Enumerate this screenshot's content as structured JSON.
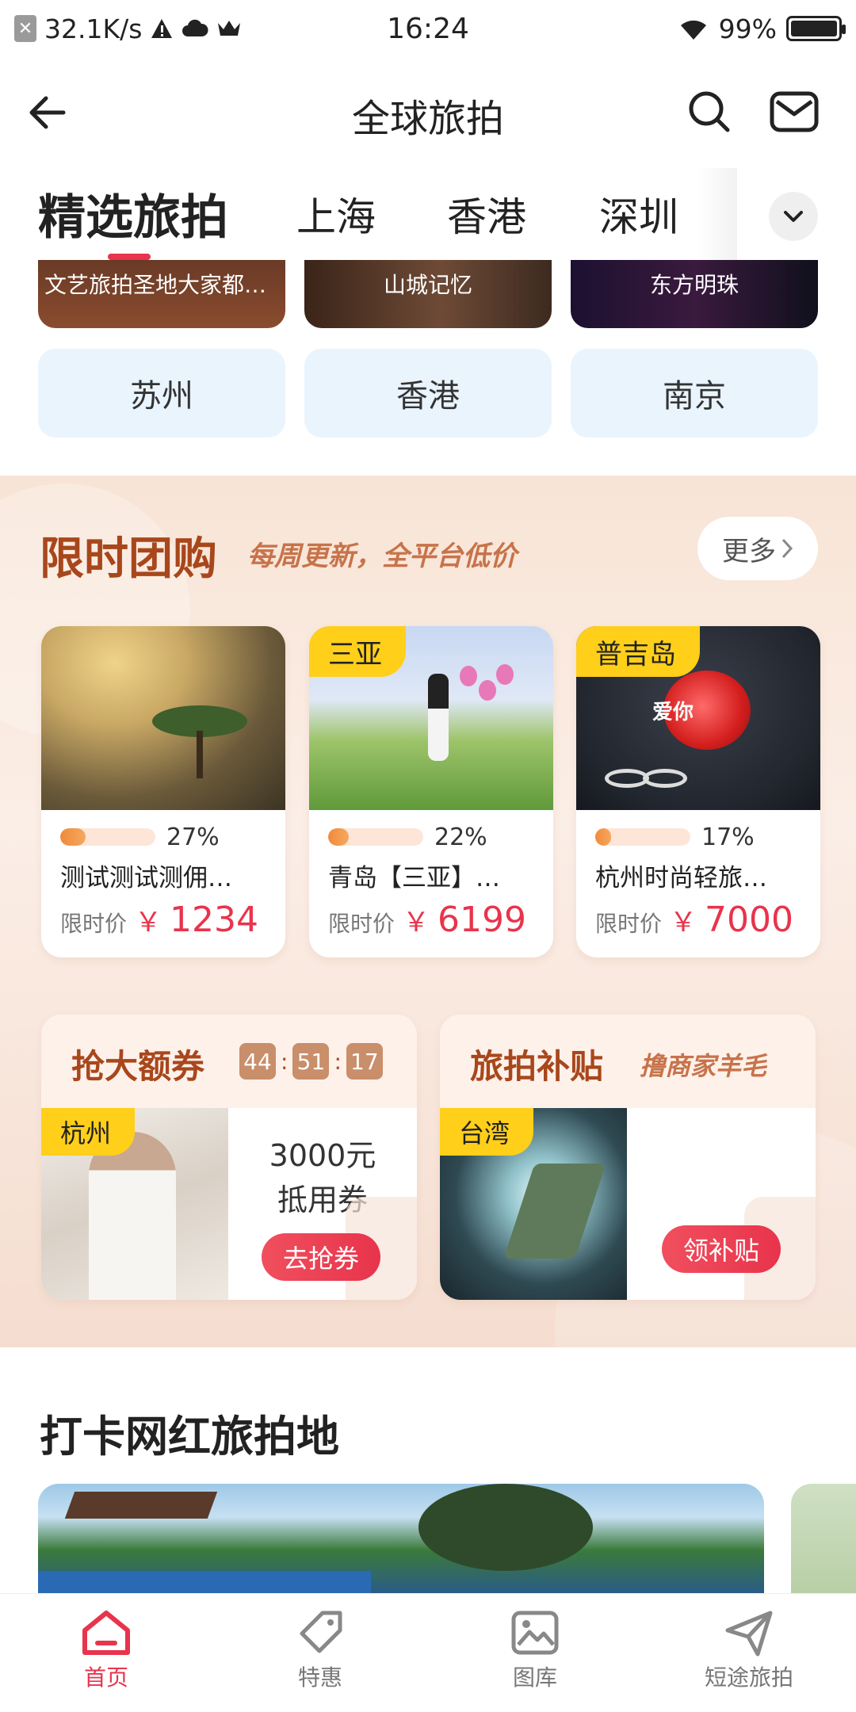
{
  "status_bar": {
    "speed": "32.1K/s",
    "time": "16:24",
    "battery": "99%"
  },
  "nav": {
    "title": "全球旅拍"
  },
  "tabs": [
    "精选旅拍",
    "上海",
    "香港",
    "深圳"
  ],
  "thumbs": [
    "文艺旅拍圣地大家都…",
    "山城记忆",
    "东方明珠"
  ],
  "city_chips": [
    "苏州",
    "香港",
    "南京"
  ],
  "group_buy": {
    "title": "限时团购",
    "slogan": "每周更新，全平台低价",
    "more_label": "更多",
    "items": [
      {
        "badge": "",
        "progress": 27,
        "progress_text": "27%",
        "name": "测试测试测佣…",
        "price_label": "限时价",
        "currency": "￥",
        "price": "1234"
      },
      {
        "badge": "三亚",
        "progress": 22,
        "progress_text": "22%",
        "name": "青岛【三亚】…",
        "price_label": "限时价",
        "currency": "￥",
        "price": "6199"
      },
      {
        "badge": "普吉岛",
        "progress": 17,
        "progress_text": "17%",
        "name": "杭州时尚轻旅…",
        "price_label": "限时价",
        "currency": "￥",
        "price": "7000"
      }
    ],
    "rose_text": "爱你"
  },
  "coupon": {
    "title": "抢大额券",
    "timer": [
      "44",
      "51",
      "17"
    ],
    "badge": "杭州",
    "desc_line1": "3000元",
    "desc_line2": "抵用券",
    "button": "去抢券"
  },
  "subsidy": {
    "title": "旅拍补贴",
    "slogan": "撸商家羊毛",
    "badge": "台湾",
    "button": "领补贴"
  },
  "checkin": {
    "title": "打卡网红旅拍地"
  },
  "tabbar": [
    {
      "label": "首页",
      "icon": "home-icon",
      "active": true
    },
    {
      "label": "特惠",
      "icon": "tag-icon",
      "active": false
    },
    {
      "label": "图库",
      "icon": "gallery-icon",
      "active": false
    },
    {
      "label": "短途旅拍",
      "icon": "paper-plane-icon",
      "active": false
    }
  ],
  "colors": {
    "accent": "#e8344c",
    "promo_title": "#a8471c",
    "badge": "#ffcf1a",
    "chip_bg": "#eaf4fd"
  }
}
